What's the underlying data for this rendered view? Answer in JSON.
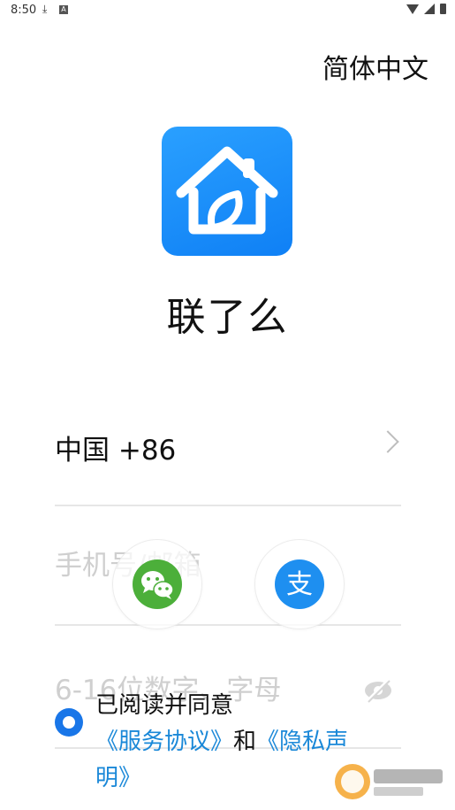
{
  "status_bar": {
    "time": "8:50",
    "download_glyph": "⤓",
    "a_glyph": "A"
  },
  "header": {
    "language": "简体中文"
  },
  "app": {
    "name": "联了么"
  },
  "country": {
    "label": "中国 +86"
  },
  "phone": {
    "placeholder": "手机号/邮箱",
    "value": ""
  },
  "password": {
    "placeholder": "6-16位数字、字母",
    "value": ""
  },
  "social": {
    "wechat_icon": "wechat-icon",
    "alipay_icon": "alipay-icon",
    "alipay_glyph": "支"
  },
  "agreement": {
    "prefix": "已阅读并同意",
    "terms": "《服务协议》",
    "and": "和",
    "privacy": "《隐私声明》"
  },
  "colors": {
    "accent": "#1a88d8",
    "icon_blue": "#1e8ff0",
    "wechat_green": "#4caf3a"
  }
}
